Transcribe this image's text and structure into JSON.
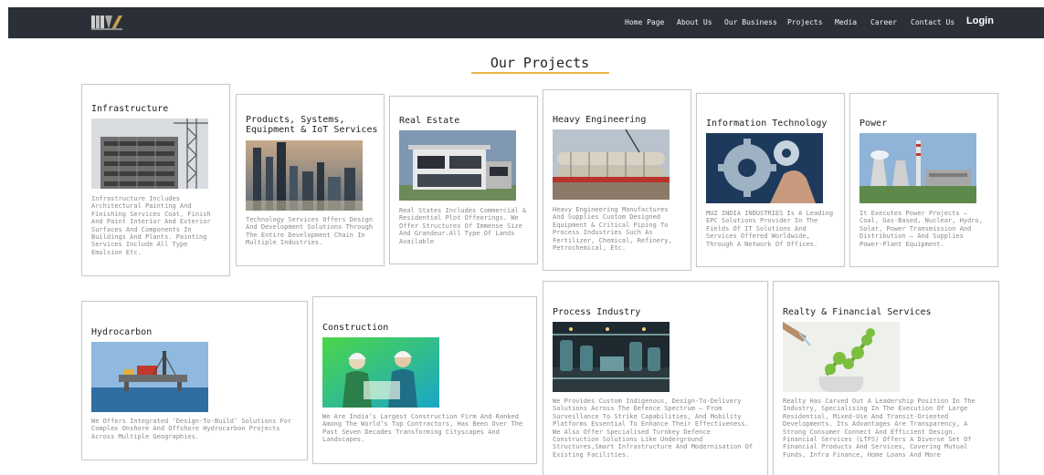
{
  "nav": {
    "items": [
      "Home Page",
      "About Us",
      "Our Business",
      "Projects",
      "Media",
      "Career",
      "Contact Us"
    ],
    "login": "Login"
  },
  "section": {
    "title": "Our Projects"
  },
  "colors": {
    "navbar": "#2b3038",
    "accent": "#e9b946",
    "desc_text": "#8a8a8a"
  },
  "cards": [
    {
      "title": "Infrastructure",
      "image": "construction-building-image",
      "desc": "Infrastructure Includes Architectural Painting And Finishing Services Coat, Finish And Paint Interior And Exterior Surfaces And Components In Buildings And Plants. Painting Services Include All Type Emulsion Etc."
    },
    {
      "title": "Products, Systems, Equipment & IoT Services",
      "image": "city-skyline-image",
      "desc": "Technology Services Offers Design And Development Solutions Through The Entire Development Chain In Multiple Industries."
    },
    {
      "title": "Real Estate",
      "image": "modern-house-image",
      "desc": "Real States Includes Commercial & Residential Plot Offeerings. We Offer Structures Of Immense Size And Grandeur.All Type Of Lands Available"
    },
    {
      "title": "Heavy Engineering",
      "image": "industrial-pipes-image",
      "desc": "Heavy Engineering Manufactures And Supplies Custom Designed Equipment & Critical Piping To Process Industries Such As Fertilizer, Chemical, Refinery, Petrochemical, Etc."
    },
    {
      "title": "Information Technology",
      "image": "gears-hand-image",
      "desc": "MUZ INDIA INDUSTRIES Is A Leading EPC Solutions Provider In The Fields Of IT Solutions And Services Offered Worldwide, Through A Network Of Offices."
    },
    {
      "title": "Power",
      "image": "power-plant-image",
      "desc": "It Executes Power Projects – Coal, Gas-Based, Nuclear, Hydro, Solar, Power Transmission And Distribution – And Supplies Power-Plant Equipment."
    },
    {
      "title": "Hydrocarbon",
      "image": "offshore-rig-image",
      "desc": "We Offers Integrated ‘Design-To-Build’ Solutions For Complex Onshore And Offshore Hydrocarbon Projects Across Multiple Geographies."
    },
    {
      "title": "Construction",
      "image": "construction-workers-image",
      "desc": "We Are India’s Largest Construction Firm And Ranked Among The World’s Top Contractors, Has Been Over The Past Seven Decades Transforming Cityscapes And Landscapes."
    },
    {
      "title": "Process Industry",
      "image": "process-plant-image",
      "desc": "We Provides Custom Indigenous, Design-To-Delivery Solutions Across The Defence Spectrum – From Surveillance To Strike Capabilities, And Mobility Platforms Essential To Enhance Their Effectiveness. We Also Offer Specialised Turnkey Defence Construction Solutions Like Underground Structures,Smart Infrastructure And Modernisation Of Existing Facilities."
    },
    {
      "title": "Realty & Financial Services",
      "image": "growth-plant-image",
      "desc": "Realty Has Carved Out A Leadership Position In The Industry, Specialising In The Execution Of Large Residential, Mixed-Use And Transit-Oriented Developments. Its Advantages Are Transparency, A Strong Consumer Connect And Efficient Design. Financial Services (LTFS) Offers A Diverse Set Of Financial Products And Services, Covering Mutual Funds, Infra Finance, Home Loans And More"
    }
  ]
}
